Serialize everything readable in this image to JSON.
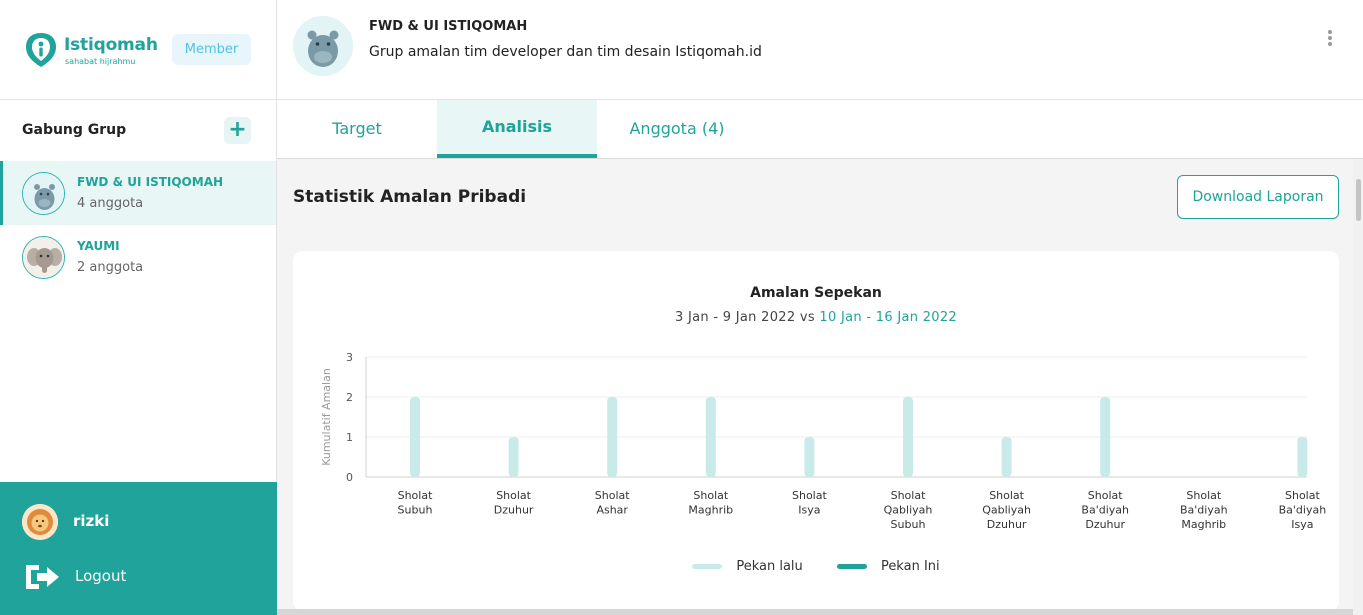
{
  "brand": {
    "name": "Istiqomah",
    "tagline": "sahabat hijrahmu",
    "badge": "Member"
  },
  "sidebar": {
    "join_label": "Gabung Grup",
    "plus": "+",
    "groups": [
      {
        "name": "FWD & UI ISTIQOMAH",
        "count": "4 anggota",
        "active": true
      },
      {
        "name": "YAUMI",
        "count": "2 anggota",
        "active": false
      }
    ],
    "user": {
      "name": "rizki"
    },
    "logout_label": "Logout"
  },
  "header": {
    "title": "FWD & UI ISTIQOMAH",
    "description": "Grup amalan tim developer dan tim desain Istiqomah.id"
  },
  "tabs": [
    {
      "label": "Target",
      "active": false
    },
    {
      "label": "Analisis",
      "active": true
    },
    {
      "label": "Anggota (4)",
      "active": false
    }
  ],
  "main": {
    "section_title": "Statistik Amalan Pribadi",
    "download_label": "Download Laporan"
  },
  "chart_data": {
    "type": "bar",
    "title": "Amalan Sepekan",
    "subtitle_prev": "3 Jan - 9 Jan 2022 vs",
    "subtitle_curr": "10 Jan - 16 Jan 2022",
    "ylabel": "Kumulatif Amalan",
    "xlabel": "",
    "ylim": [
      0,
      3
    ],
    "yticks": [
      0,
      1,
      2,
      3
    ],
    "categories": [
      [
        "Sholat",
        "Subuh"
      ],
      [
        "Sholat",
        "Dzuhur"
      ],
      [
        "Sholat",
        "Ashar"
      ],
      [
        "Sholat",
        "Maghrib"
      ],
      [
        "Sholat",
        "Isya"
      ],
      [
        "Sholat",
        "Qabliyah",
        "Subuh"
      ],
      [
        "Sholat",
        "Qabliyah",
        "Dzuhur"
      ],
      [
        "Sholat",
        "Ba'diyah",
        "Dzuhur"
      ],
      [
        "Sholat",
        "Ba'diyah",
        "Maghrib"
      ],
      [
        "Sholat",
        "Ba'diyah",
        "Isya"
      ]
    ],
    "series": [
      {
        "name": "Pekan lalu",
        "color": "#c8ebea",
        "values": [
          2,
          1,
          2,
          2,
          1,
          2,
          1,
          2,
          0,
          1
        ]
      },
      {
        "name": "Pekan Ini",
        "color": "#1fa39a",
        "values": [
          0,
          0,
          0,
          0,
          0,
          0,
          0,
          0,
          0,
          0
        ]
      }
    ],
    "grid": true,
    "legend": "bottom"
  },
  "colors": {
    "accent": "#1fa39a",
    "accent_light": "#e8f6f5",
    "member_badge": "#4fc3e6"
  }
}
